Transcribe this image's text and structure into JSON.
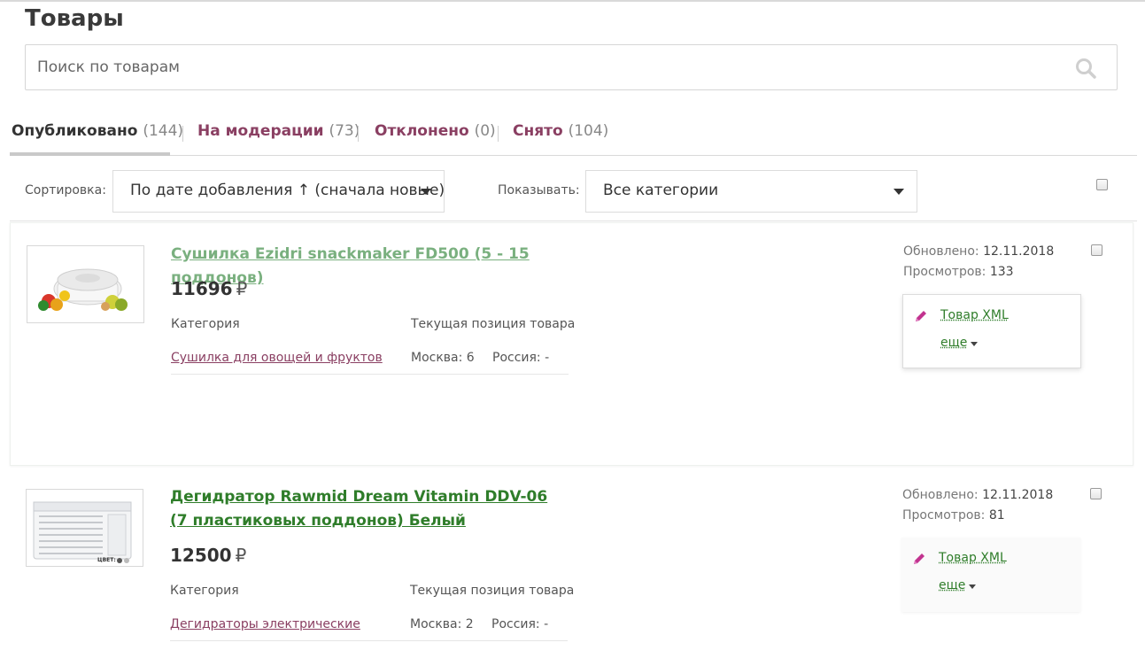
{
  "page_title": "Товары",
  "search": {
    "placeholder": "Поиск по товарам"
  },
  "tabs": [
    {
      "label": "Опубликовано",
      "count": "(144)"
    },
    {
      "label": "На модерации",
      "count": "(73)"
    },
    {
      "label": "Отклонено",
      "count": "(0)"
    },
    {
      "label": "Снято",
      "count": "(104)"
    }
  ],
  "filters": {
    "sort_label": "Сортировка:",
    "sort_value": "По дате добавления ↑ (сначала новые)",
    "show_label": "Показывать:",
    "show_value": "Все категории"
  },
  "products": [
    {
      "title": "Сушилка Ezidri snackmaker FD500 (5 - 15 поддонов)",
      "price": "11696",
      "currency": "₽",
      "category_label": "Категория",
      "category": "Сушилка для овощей и фруктов",
      "position_label": "Текущая позиция товара",
      "moscow": "Москва: 6",
      "russia": "Россия: -",
      "updated_label": "Обновлено:",
      "updated": "12.11.2018",
      "views_label": "Просмотров:",
      "views": "133",
      "xml_label": "Товар XML",
      "more_label": "еще"
    },
    {
      "title": "Дегидратор Rawmid Dream Vitamin DDV-06 (7 пластиковых поддонов) Белый",
      "price": "12500",
      "currency": "₽",
      "category_label": "Категория",
      "category": "Дегидраторы электрические",
      "position_label": "Текущая позиция товара",
      "moscow": "Москва: 2",
      "russia": "Россия: -",
      "updated_label": "Обновлено:",
      "updated": "12.11.2018",
      "views_label": "Просмотров:",
      "views": "81",
      "xml_label": "Товар XML",
      "more_label": "еще",
      "image_text": "ЦВЕТ:"
    }
  ]
}
